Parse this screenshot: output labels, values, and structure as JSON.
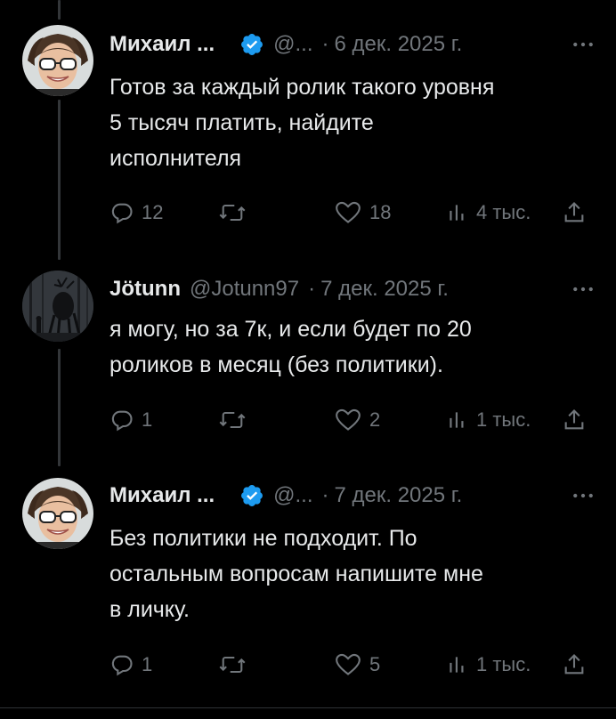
{
  "tweets": [
    {
      "author_name": "Михаил ...",
      "handle": "@...",
      "separator": "·",
      "date": "6 дек. 2025 г.",
      "verified": true,
      "text_lines": [
        "Готов за каждый ролик такого уровня",
        "5 тысяч платить, найдите",
        "исполнителя"
      ],
      "replies": "12",
      "retweets": "",
      "likes": "18",
      "views": "4 тыс.",
      "avatar_icon": "smiling-man-sunglasses-avatar"
    },
    {
      "author_name": "Jötunn",
      "handle": "@Jotunn97",
      "separator": "·",
      "date": "7 дек. 2025 г.",
      "verified": false,
      "text_lines": [
        "я могу, но за 7к, и если будет по 20",
        "роликов в месяц (без политики)."
      ],
      "replies": "1",
      "retweets": "",
      "likes": "2",
      "views": "1 тыс.",
      "avatar_icon": "dark-forest-creature-avatar"
    },
    {
      "author_name": "Михаил ...",
      "handle": "@...",
      "separator": "·",
      "date": "7 дек. 2025 г.",
      "verified": true,
      "text_lines": [
        "Без политики не подходит. По",
        "остальным вопросам напишите мне",
        "в личку."
      ],
      "replies": "1",
      "retweets": "",
      "likes": "5",
      "views": "1 тыс.",
      "avatar_icon": "smiling-man-sunglasses-avatar"
    }
  ],
  "colors": {
    "background": "#000000",
    "text": "#e7e9ea",
    "secondary": "#71767b",
    "verified_blue": "#1d9bf0",
    "thread_line": "#333639"
  },
  "icons": {
    "more": "more-dots-icon",
    "reply": "reply-bubble-icon",
    "retweet": "retweet-arrows-icon",
    "like": "heart-outline-icon",
    "views": "views-bar-chart-icon",
    "share": "share-upload-icon"
  }
}
